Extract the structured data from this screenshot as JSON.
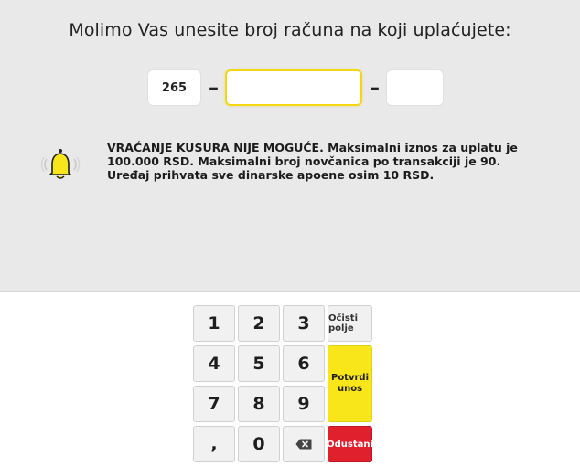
{
  "header": {
    "title": "Molimo Vas unesite broj računa na koji uplaćujete:"
  },
  "account": {
    "prefix": "265",
    "separator": "–",
    "main": "",
    "suffix": ""
  },
  "notice": {
    "icon": "bell-icon",
    "text_line1": "VRAĆANJE KUSURA NIJE MOGUĆE. Maksimalni iznos za uplatu je",
    "text_line2": "100.000 RSD. Maksimalni broj novčanica po transakciji je 90.",
    "text_line3": "Uređaj prihvata sve dinarske apoene osim 10 RSD."
  },
  "keypad": {
    "keys": [
      "1",
      "2",
      "3",
      "4",
      "5",
      "6",
      "7",
      "8",
      "9",
      ",",
      "0"
    ],
    "backspace_icon": "backspace-icon",
    "clear_label": "Očisti polje",
    "confirm_line1": "Potvrdi",
    "confirm_line2": "unos",
    "cancel_label": "Odustani"
  },
  "colors": {
    "accent_yellow": "#f8e51a",
    "cancel_red": "#e0202d",
    "panel_grey": "#e9e9e9"
  }
}
